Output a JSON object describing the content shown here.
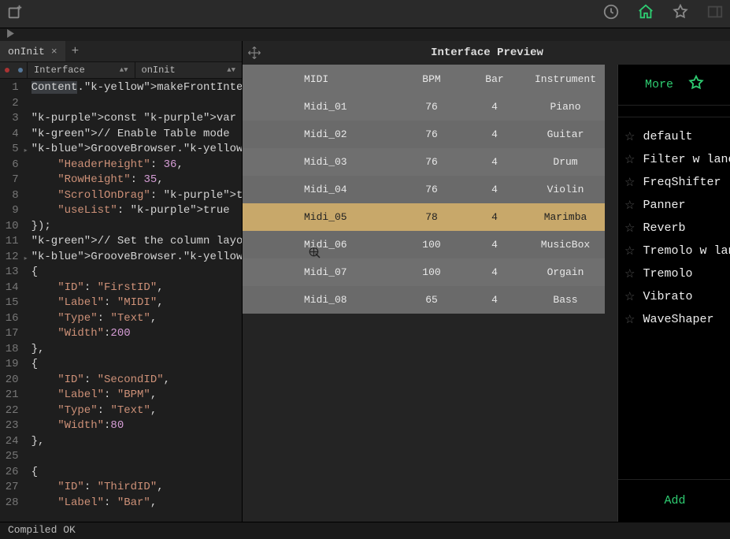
{
  "tab": {
    "label": "onInit"
  },
  "combos": {
    "left": "Interface",
    "right": "onInit"
  },
  "code_lines": [
    "Content.makeFrontInterface(",
    "",
    "const var GrooveBrowser = C",
    "// Enable Table mode",
    "GrooveBrowser.setTableMode(",
    "    \"HeaderHeight\": 36,",
    "    \"RowHeight\": 35,",
    "    \"ScrollOnDrag\": true,",
    "    \"useList\": true",
    "});",
    "// Set the column layout",
    "GrooveBrowser.setTableColum",
    "{",
    "    \"ID\": \"FirstID\",",
    "    \"Label\": \"MIDI\",",
    "    \"Type\": \"Text\",",
    "    \"Width\":200",
    "},",
    "{",
    "    \"ID\": \"SecondID\",",
    "    \"Label\": \"BPM\",",
    "    \"Type\": \"Text\",",
    "    \"Width\":80",
    "},",
    "",
    "{",
    "    \"ID\": \"ThirdID\",",
    "    \"Label\": \"Bar\","
  ],
  "preview": {
    "title": "Interface Preview"
  },
  "chart_data": {
    "type": "table",
    "columns": [
      "MIDI",
      "BPM",
      "Bar",
      "Instrument"
    ],
    "rows": [
      {
        "midi": "Midi_01",
        "bpm": "76",
        "bar": "4",
        "instrument": "Piano",
        "selected": false
      },
      {
        "midi": "Midi_02",
        "bpm": "76",
        "bar": "4",
        "instrument": "Guitar",
        "selected": false
      },
      {
        "midi": "Midi_03",
        "bpm": "76",
        "bar": "4",
        "instrument": "Drum",
        "selected": false
      },
      {
        "midi": "Midi_04",
        "bpm": "76",
        "bar": "4",
        "instrument": "Violin",
        "selected": false
      },
      {
        "midi": "Midi_05",
        "bpm": "78",
        "bar": "4",
        "instrument": "Marimba",
        "selected": true
      },
      {
        "midi": "Midi_06",
        "bpm": "100",
        "bar": "4",
        "instrument": "MusicBox",
        "selected": false
      },
      {
        "midi": "Midi_07",
        "bpm": "100",
        "bar": "4",
        "instrument": "Orgain",
        "selected": false
      },
      {
        "midi": "Midi_08",
        "bpm": "65",
        "bar": "4",
        "instrument": "Bass",
        "selected": false
      }
    ]
  },
  "side": {
    "more": "More",
    "add": "Add",
    "presets": [
      "default",
      "Filter w lane",
      "FreqShifter",
      "Panner",
      "Reverb",
      "Tremolo w lan",
      "Tremolo",
      "Vibrato",
      "WaveShaper"
    ]
  },
  "status": "Compiled OK"
}
